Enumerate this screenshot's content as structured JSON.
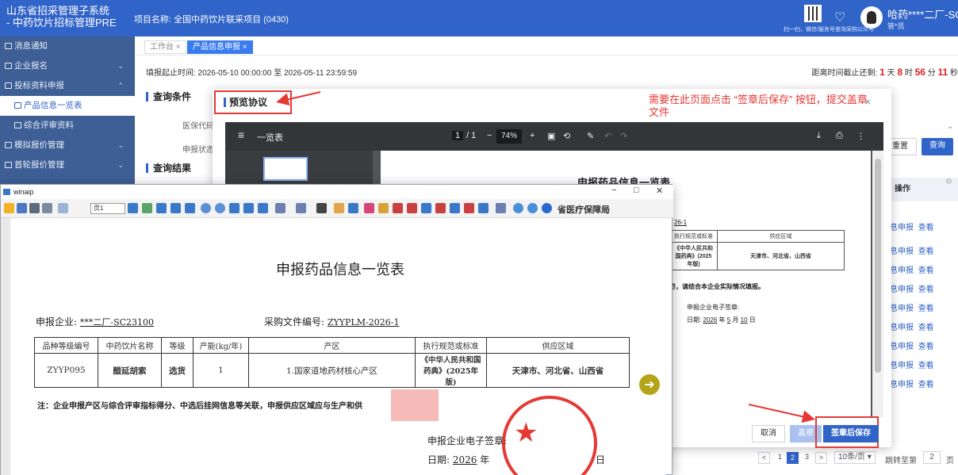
{
  "header": {
    "app_title_line1": "山东省招采管理子系统",
    "app_title_line2": "- 中药饮片招标管理PRE",
    "project": "项目名称: 全国中药饮片联采项目 (0430)",
    "qr_caption": "扫一扫，微信/服务号查询采购公众号",
    "user_name": "哈药****二厂-SC...",
    "user_role": "管*员"
  },
  "sidebar": {
    "items": [
      {
        "label": "消息通知",
        "expandable": false
      },
      {
        "label": "企业报名",
        "expandable": true
      },
      {
        "label": "投标资料申报",
        "expandable": true,
        "expanded": true
      },
      {
        "label": "产品信息一览表",
        "sub": true,
        "active": true
      },
      {
        "label": "综合评审资料",
        "sub": true
      },
      {
        "label": "模拟报价管理",
        "expandable": true
      },
      {
        "label": "首轮报价管理",
        "expandable": true
      }
    ]
  },
  "tabs": [
    {
      "label": "工作台 ×"
    },
    {
      "label": "产品信息申报 ×",
      "active": true
    }
  ],
  "main": {
    "deadline": "填报起止时间: 2026-05-10 00:00:00 至 2026-05-11 23:59:59",
    "countdown_prefix": "距离时间截止还剩: ",
    "countdown": {
      "days": "1",
      "hours": "8",
      "minutes": "56",
      "seconds": "11"
    },
    "countdown_units": {
      "d": " 天 ",
      "h": " 时 ",
      "m": " 分 ",
      "s": " 秒"
    },
    "query_title": "查询条件",
    "field_code": "医保代码",
    "field_status": "申报状态",
    "results_title": "查询结果",
    "reset_label": "重置",
    "query_label": "查询",
    "col_action": "操作",
    "row_action_1": "信息申报",
    "row_action_2": "查看",
    "pager_size": "10条/页",
    "pager_goto": "跳转至第",
    "pager_goto_value": "2",
    "pager_page_unit": "页",
    "pages": [
      "1",
      "2",
      "3"
    ]
  },
  "modal": {
    "title": "预览协议",
    "annotation": "需要在此页面点击 “签章后保存” 按钮，提交盖章文件",
    "pdf": {
      "menu": "≡",
      "doc_name": "一览表",
      "page_current": "1",
      "page_total": "/ 1",
      "zoom": "74%",
      "page_title": "申报药品信息一览表",
      "line_no": "26-1",
      "col_std": "执行规范或标准",
      "col_area": "供应区域",
      "std_value": "《中华人民共和国药典》(2025年版)",
      "area_value": "天津市、河北省、山西省",
      "note": "符，请结合本企业实际情况填报。",
      "sign_label": "申报企业电子签章:",
      "date_label": "日期:",
      "date_year": "2026",
      "date_month": "5",
      "date_day": "10",
      "year_unit": "年",
      "month_unit": "月",
      "day_unit": "日"
    },
    "cancel_label": "取消",
    "seal_label": "盖章",
    "save_label": "签章后保存"
  },
  "winaip": {
    "title": "winaip",
    "page_label": "页1",
    "org_label": "省医疗保障局",
    "doc": {
      "title": "申报药品信息一览表",
      "company_label": "申报企业:",
      "company_value": "***二厂-SC23100",
      "doc_no_label": "采购文件编号:",
      "doc_no_value": "ZYYPLM-2026-1",
      "headers": [
        "品种等级编号",
        "中药饮片名称",
        "等级",
        "产能(kg/年)",
        "产区",
        "执行规范或标准",
        "供应区域"
      ],
      "row": [
        "ZYYP095",
        "醋延胡索",
        "选货",
        "1",
        "1.国家道地药材核心产区",
        "《中华人民共和国药典》(2025年版)",
        "天津市、河北省、山西省"
      ],
      "note": "注：企业申报产区与综合评审指标得分、中选后挂网信息等关联，申报供应区域应与生产和供应能力相符，请结合本企业实际情况填报。",
      "sign_label": "申报企业电子签章:",
      "date_label": "日期:",
      "date_year": "2026",
      "year_unit": "年",
      "day_unit": "日"
    }
  },
  "colors": {
    "header_blue": "#3164c8",
    "sidebar_bg": "#3d5f95",
    "annotation_red": "#e53935",
    "countdown_red": "#e02020"
  }
}
